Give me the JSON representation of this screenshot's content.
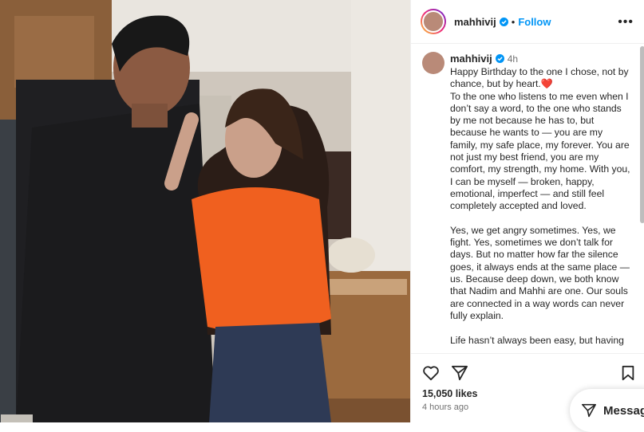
{
  "post": {
    "username": "mahhivij",
    "follow_label": "Follow",
    "separator": "•",
    "more_label": "•••",
    "time_ago_short": "4h",
    "caption": "Happy Birthday to the one I chose, not by chance, but by heart.❤️\nTo the one who listens to me even when I don’t say a word, to the one who stands by me not because he has to, but because he wants to — you are my family, my safe place, my forever. You are not just my best friend, you are my comfort, my strength, my home. With you, I can be myself — broken, happy, emotional, imperfect — and still feel completely accepted and loved.\n\nYes, we get angry sometimes. Yes, we fight. Yes, sometimes we don’t talk for days. But no matter how far the silence goes, it always ends at the same place — us. Because deep down, we both know that Nadim and Mahhi are one. Our souls are connected in a way words can never fully explain.\n\nLife hasn’t always been easy, but having",
    "likes": "15,050 likes",
    "time_ago": "4 hours ago"
  },
  "messages_label": "Messages",
  "icons": {
    "verified": "verified-badge-icon",
    "like": "heart-icon",
    "share": "send-icon",
    "save": "bookmark-icon",
    "messages": "send-icon"
  },
  "colors": {
    "accent": "#0095f6",
    "text": "#262626",
    "muted": "#737373"
  }
}
